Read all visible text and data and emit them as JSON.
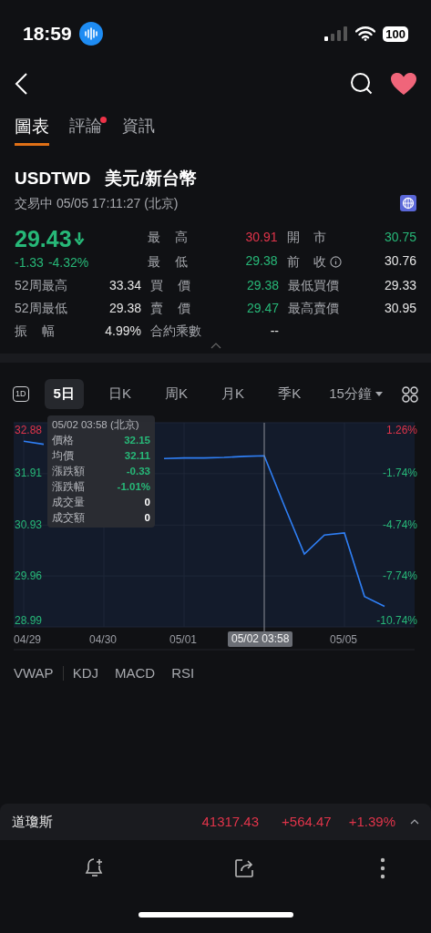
{
  "status_bar": {
    "time": "18:59",
    "battery": "100"
  },
  "tabs": [
    {
      "label": "圖表",
      "selected": true,
      "badge": false
    },
    {
      "label": "評論",
      "selected": false,
      "badge": true
    },
    {
      "label": "資訊",
      "selected": false,
      "badge": false
    }
  ],
  "instrument": {
    "symbol": "USDTWD",
    "name": "美元/新台幣",
    "status": "交易中 05/05 17:11:27 (北京)"
  },
  "quote": {
    "price": "29.43",
    "change": "-1.33",
    "change_pct": "-4.32%",
    "falling": true,
    "color": "#27b878"
  },
  "stat_rows": [
    [
      {
        "label": "最 高",
        "value": "30.91",
        "color": "#e0344a"
      },
      {
        "label": "開 市",
        "value": "30.75",
        "color": "#27b878"
      }
    ],
    [
      {
        "label": "最 低",
        "value": "29.38",
        "color": "#27b878"
      },
      {
        "label": "前 收",
        "value": "30.76",
        "color": "#e6e6e6",
        "info": true
      }
    ],
    [
      {
        "label": "52周最高",
        "value": "33.34",
        "color": "#e6e6e6"
      },
      {
        "label": "買 價",
        "value": "29.38",
        "color": "#27b878"
      },
      {
        "label": "最低買價",
        "value": "29.33",
        "color": "#e6e6e6"
      }
    ],
    [
      {
        "label": "52周最低",
        "value": "29.38",
        "color": "#e6e6e6"
      },
      {
        "label": "賣 價",
        "value": "29.47",
        "color": "#27b878"
      },
      {
        "label": "最高賣價",
        "value": "30.95",
        "color": "#e6e6e6"
      }
    ],
    [
      {
        "label": "振 幅",
        "value": "4.99%",
        "color": "#e6e6e6"
      },
      {
        "label": "合約乘數",
        "value": "--",
        "color": "#e6e6e6"
      }
    ]
  ],
  "periods": [
    {
      "label": "1D",
      "kind": "icon",
      "selected": false
    },
    {
      "label": "5日",
      "kind": "text",
      "selected": true
    },
    {
      "label": "日K",
      "kind": "text",
      "selected": false
    },
    {
      "label": "周K",
      "kind": "text",
      "selected": false
    },
    {
      "label": "月K",
      "kind": "text",
      "selected": false
    },
    {
      "label": "季K",
      "kind": "text",
      "selected": false
    },
    {
      "label": "15分鐘",
      "kind": "dropdown",
      "selected": false
    }
  ],
  "chart": {
    "crosshair_label": "05/02 03:58",
    "chart_data": {
      "type": "line",
      "grid": true,
      "ylim": [
        28.99,
        32.88
      ],
      "yticks": [
        {
          "value": 32.88,
          "label": "32.88"
        },
        {
          "value": 31.91,
          "label": "31.91"
        },
        {
          "value": 30.93,
          "label": "30.93"
        },
        {
          "value": 29.96,
          "label": "29.96"
        },
        {
          "value": 28.99,
          "label": "28.99"
        }
      ],
      "categories": [
        "04/29",
        null,
        null,
        null,
        "04/30",
        null,
        null,
        null,
        "05/01",
        null,
        null,
        null,
        null,
        null,
        null,
        null,
        "05/05",
        null,
        null,
        null
      ],
      "series": [
        {
          "color": "#2f7ff5",
          "values": [
            32.53,
            32.47,
            null,
            null,
            null,
            null,
            null,
            32.2,
            32.21,
            32.21,
            32.22,
            32.24,
            32.25,
            31.3,
            30.38,
            30.74,
            30.78,
            29.57,
            29.38,
            null
          ]
        }
      ]
    },
    "percent_labels": [
      {
        "text": "1.26%",
        "color": "#e0344a"
      },
      {
        "text": "-1.74%",
        "color": "#27b878"
      },
      {
        "text": "-4.74%",
        "color": "#27b878"
      },
      {
        "text": "-7.74%",
        "color": "#27b878"
      },
      {
        "text": "-10.74%",
        "color": "#27b878"
      }
    ],
    "tooltip": {
      "title": "05/02 03:58 (北京)",
      "rows": [
        {
          "label": "價格",
          "value": "32.15",
          "color": "#27b878"
        },
        {
          "label": "均價",
          "value": "32.11",
          "color": "#27b878"
        },
        {
          "label": "漲跌額",
          "value": "-0.33",
          "color": "#27b878"
        },
        {
          "label": "漲跌幅",
          "value": "-1.01%",
          "color": "#27b878"
        },
        {
          "label": "成交量",
          "value": "0",
          "color": "#ffffff"
        },
        {
          "label": "成交額",
          "value": "0",
          "color": "#ffffff"
        }
      ]
    }
  },
  "indicators": [
    "VWAP",
    "KDJ",
    "MACD",
    "RSI"
  ],
  "ticker": {
    "name": "道瓊斯",
    "price": "41317.43",
    "change": "+564.47",
    "change_pct": "+1.39%",
    "color": "#e0344a"
  }
}
